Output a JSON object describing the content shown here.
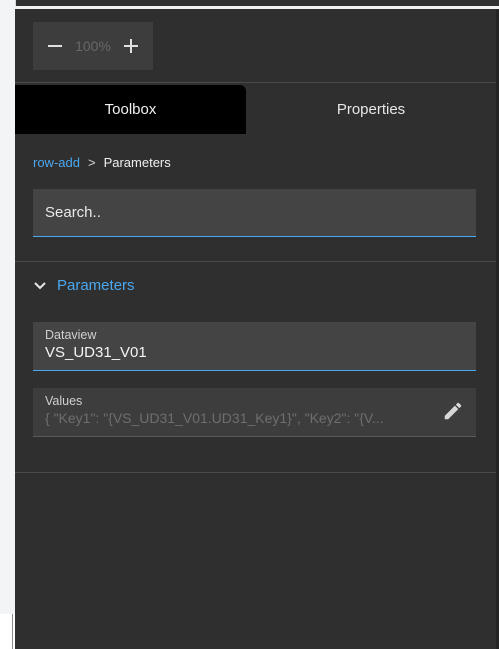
{
  "zoom": {
    "level": "100%",
    "minus_icon": "minus-icon",
    "plus_icon": "plus-icon"
  },
  "tabs": [
    {
      "label": "Toolbox",
      "active": true
    },
    {
      "label": "Properties",
      "active": false
    }
  ],
  "breadcrumb": {
    "parent": "row-add",
    "separator": ">",
    "current": "Parameters"
  },
  "search": {
    "placeholder": "Search.."
  },
  "section": {
    "title": "Parameters",
    "icon": "chevron-down-icon"
  },
  "fields": {
    "dataview": {
      "label": "Dataview",
      "value": "VS_UD31_V01"
    },
    "values": {
      "label": "Values",
      "value": "{ \"Key1\": \"{VS_UD31_V01.UD31_Key1}\", \"Key2\": \"{V...",
      "icon": "pencil-icon"
    }
  },
  "colors": {
    "accent": "#4aa8f0",
    "panel_bg": "#2f2f2f",
    "field_bg": "#3d3d3d",
    "active_tab_bg": "#000000"
  }
}
